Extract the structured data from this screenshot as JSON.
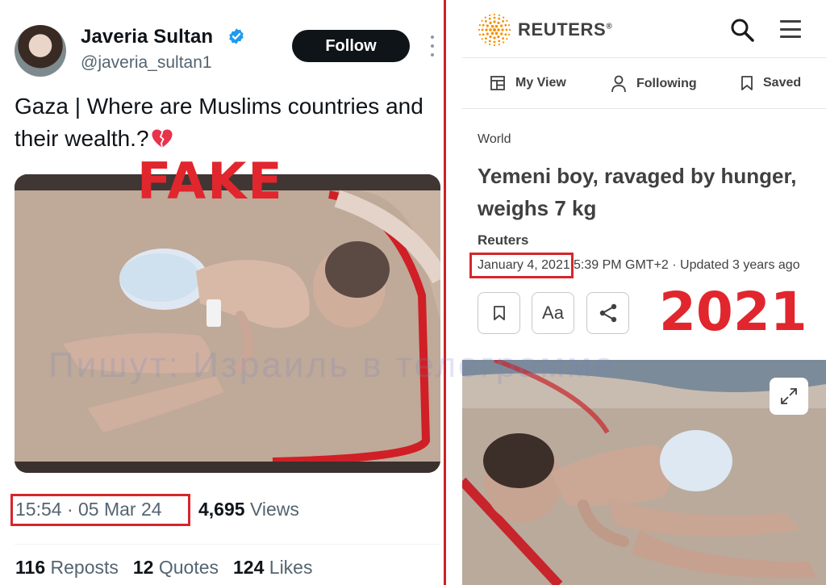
{
  "tweet": {
    "display_name": "Javeria Sultan",
    "handle": "@javeria_sultan1",
    "follow_label": "Follow",
    "text": "Gaza | Where are Muslims countries and their wealth.?",
    "timestamp": "15:54 · 05 Mar 24",
    "views_count": "4,695",
    "views_label": " Views",
    "reposts_count": "116",
    "reposts_label": " Reposts",
    "quotes_count": "12",
    "quotes_label": " Quotes",
    "likes_count": "124",
    "likes_label": " Likes",
    "verified_color": "#1d9bf0"
  },
  "overlay": {
    "fake_label": "FAKE",
    "year_label": "2021",
    "watermark": "Пишут: Израиль в телеграмме",
    "highlight_color": "#d6262b"
  },
  "reuters": {
    "brand": "REUTERS",
    "brand_mark": "®",
    "nav": [
      {
        "label": "My View",
        "icon": "layout-icon"
      },
      {
        "label": "Following",
        "icon": "person-icon"
      },
      {
        "label": "Saved",
        "icon": "bookmark-icon"
      }
    ],
    "section": "World",
    "headline": "Yemeni boy, ravaged by hunger, weighs 7 kg",
    "author": "Reuters",
    "date": "January 4, 2021",
    "time_updated": "5:39 PM GMT+2 · Updated 3 years ago",
    "text_size_label": "Aa",
    "accent": "#f29100"
  }
}
